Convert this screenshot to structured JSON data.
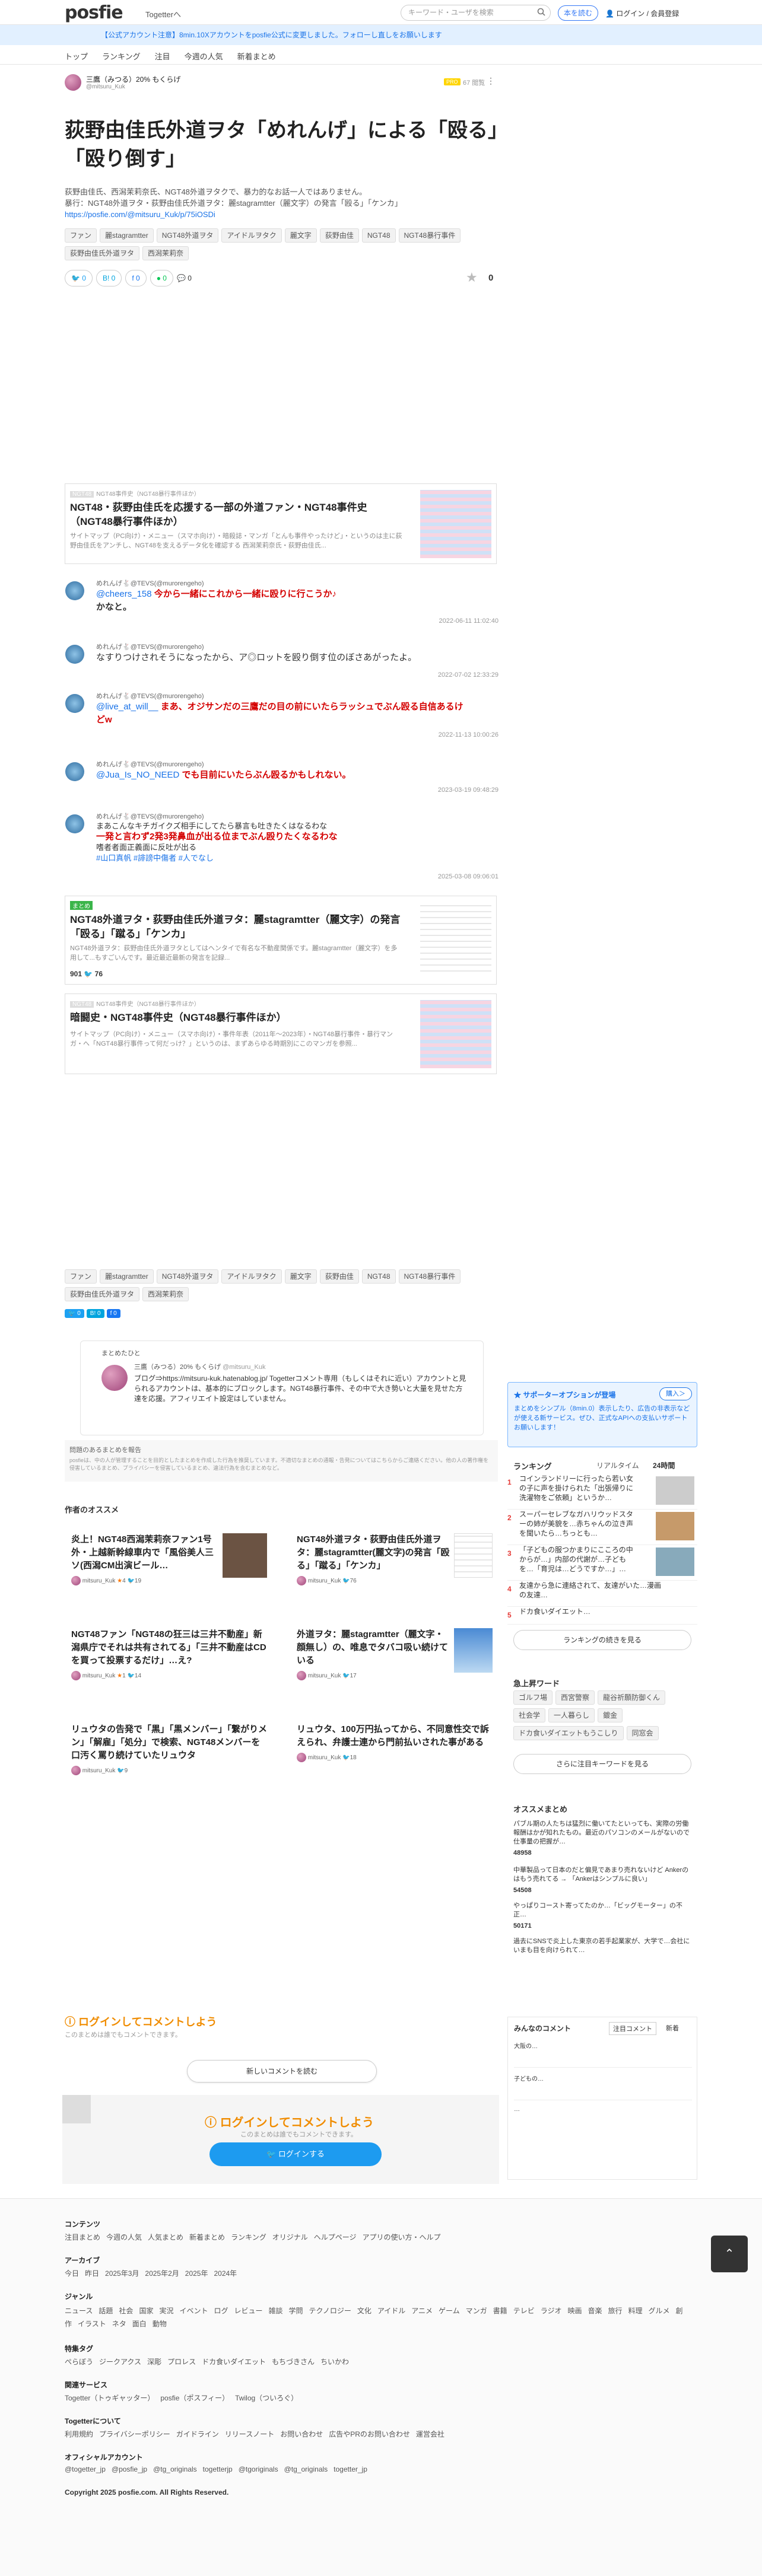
{
  "header": {
    "logo_main": "posfie",
    "logo_suffix": "Togetterへ",
    "search_placeholder": "キーワード・ユーザを検索",
    "cta": "本を読む",
    "login": "ログイン / 会員登録"
  },
  "notice": "【公式アカウント注意】8min.10Xアカウントをposfie公式に変更しました。フォローし直しをお願いします",
  "nav": [
    "トップ",
    "ランキング",
    "注目",
    "今週の人気",
    "新着まとめ"
  ],
  "author": {
    "name": "三鷹（みつる）20% もくらげ",
    "handle": "@mitsuru_Kuk",
    "badge": "PRO",
    "views": "67 閲覧"
  },
  "title": "荻野由佳氏外道ヲタ「めれんげ」による「殴る」「殴り倒す」",
  "desc": [
    "荻野由佳氏、西潟茉莉奈氏、NGT48外道ヲタクで、暴力的なお話一人ではありません。",
    "暴行：NGT48外道ヲタ・荻野由佳氏外道ヲタ：麗stagramtter（麗文字）の発言「殴る」「ケンカ」",
    "https://posfie.com/@mitsuru_Kuk/p/75iOSDi"
  ],
  "tags": [
    "ファン",
    "麗stagramtter",
    "NGT48外道ヲタ",
    "アイドルヲタク",
    "麗文字",
    "荻野由佳",
    "NGT48",
    "NGT48暴行事件",
    "荻野由佳氏外道ヲタ",
    "西潟茉莉奈"
  ],
  "shares": {
    "twitter": "0",
    "hatena": "0",
    "facebook": "0",
    "line": "0",
    "comments": "0",
    "stars": "0"
  },
  "card1": {
    "label": "NGT48",
    "crumb": "NGT48事件史（NGT48暴行事件ほか）",
    "title": "NGT48・荻野由佳氏を応援する一部の外道ファン・NGT48事件史（NGT48暴行事件ほか）",
    "desc": "サイトマップ（PC向け）・メニュー（スマホ向け）・暗殺誌・マンガ「とんも事件やったけど」・というのは主に荻野由佳氏をアンチし、NGT48を支えるデータ化を確認する 西潟茉莉奈氏・荻野由佳氏..."
  },
  "tweets": [
    {
      "user": "めれんげ🐇@TEVS(@murorengeho)",
      "text": "今から一緒にこれから一緒に殴りに行こうか♪",
      "pre": "@cheers_158",
      "post": "かなと。",
      "date": "2022-06-11 11:02:40"
    },
    {
      "user": "めれんげ🐇@TEVS(@murorengeho)",
      "text": "なすりつけされそうになったから、ア◎ロットを殴り倒す位のぼさあがったよ。",
      "pre": "",
      "post": "",
      "date": "2022-07-02 12:33:29"
    },
    {
      "user": "めれんげ🐇@TEVS(@murorengeho)",
      "text": "まあ、オジサンだの三鷹だの目の前にいたらラッシュでぶん殴る自信あるけどw",
      "pre": "@live_at_will__",
      "post": "",
      "date": "2022-11-13 10:00:26"
    },
    {
      "user": "めれんげ🐇@TEVS(@murorengeho)",
      "text": "でも目前にいたらぶん殴るかもしれない。",
      "pre": "@Jua_Is_NO_NEED",
      "post": "",
      "date": "2023-03-19 09:48:29"
    },
    {
      "user": "めれんげ🐇@TEVS(@murorengeho)",
      "text": "一発と言わず2発3発鼻血が出る位までぶん殴りたくなるわな",
      "pre": "まあこんなキチガイクズ相手にしてたら暴言も吐きたくはなるわな",
      "post": "",
      "date": "2025-03-08 09:06:01"
    }
  ],
  "tweet5": {
    "l3": "嗜者者面正義面に反吐が出る",
    "l4": "#山口真帆 #誹謗中傷者 #人でなし"
  },
  "card2": {
    "label": "まとめ",
    "title": "NGT48外道ヲタ・荻野由佳氏外道ヲタ：麗stagramtter（麗文字）の発言「殴る」「蹴る」「ケンカ」",
    "desc": "NGT48外道ヲタ：荻野由佳氏外道ヲタとしてはヘンタイで有名な不動産関係です。麗stagramtter（麗文字）を多用して...もすごいんです。最近最近最新の発言を記録...",
    "count": "901",
    "likes": "76"
  },
  "card3": {
    "label": "NGT48",
    "crumb": "NGT48事件史（NGT48暴行事件ほか）",
    "title": "暗闘史・NGT48事件史（NGT48暴行事件ほか）",
    "desc": "サイトマップ（PC向け）・メニュー（スマホ向け）・事件年表（2011年〜2023年）・NGT48暴行事件・暴行マンガ・へ「NGT48暴行事件って何だっけ？」というのは、まずあらゆる時期別にこのマンガを参照..."
  },
  "author_box": {
    "label": "まとめたひと",
    "name": "三鷹（みつる）20% もくらげ",
    "handle": "@mitsuru_Kuk",
    "bio": "ブログ⇒https://mitsuru-kuk.hatenablog.jp/ Togetterコメント専用（もしくはそれに近い）アカウントと見られるアカウントは、基本的にブロックします。NGT48暴行事件、その中で大き勢いと大量を見せた方達を応援。アフィリエイト設定はしていません。"
  },
  "report": {
    "title": "問題のあるまとめを報告",
    "text": "posfieは、中の人が管理することを目的としたまとめを作成した行為を推奨しています。不適切なまとめの通報・告発についてはこちらからご連絡ください。他の人の著作権を侵害しているまとめ、プライバシーを侵害しているまとめ、違法行為を含むまとめなど。"
  },
  "recommend_title": "作者のオススメ",
  "recommends": [
    {
      "title": "炎上！NGT48西潟茉莉奈ファン1号外・上越新幹線車内で「風俗美人三ソ(西潟CM出演ビール…",
      "user": "mitsuru_Kuk",
      "likes": "4",
      "rt": "19"
    },
    {
      "title": "NGT48外道ヲタ・荻野由佳氏外道ヲタ：麗stagramtter(麗文字)の発言「殴る」「蹴る」「ケンカ」",
      "user": "mitsuru_Kuk",
      "likes": "",
      "rt": "76"
    },
    {
      "title": "NGT48ファン「NGT48の狂三は三井不動産」新潟県庁でそれは共有されてる」「三井不動産はCDを買って投票するだけ」…え?",
      "user": "mitsuru_Kuk",
      "likes": "1",
      "rt": "14"
    },
    {
      "title": "外道ヲタ：麗stagramtter（麗文字・顔無し）の、唯息でタバコ吸い続けている",
      "user": "mitsuru_Kuk",
      "likes": "",
      "rt": "17"
    },
    {
      "title": "リュウタの告発で「黒」「黒メンバー」「繋がりメン」「解雇」「処分」で検索、NGT48メンバーを口汚く罵り続けていたリュウタ",
      "user": "mitsuru_Kuk",
      "likes": "9",
      "rt": ""
    },
    {
      "title": "リュウタ、100万円払ってから、不同意性交で訴えられ、弁護士連から門前払いされた事がある",
      "user": "mitsuru_Kuk",
      "likes": "",
      "rt": "18"
    }
  ],
  "sidebar": {
    "support": {
      "title": "サポーターオプションが登場",
      "btn": "購入＞",
      "text": "まとめをシンプル（8min.0）表示したり、広告の非表示などが使える新サービス。ぜひ、正式なAPIへの支払いサポートお願いします！"
    },
    "ranking_title": "ランキング",
    "tabs": [
      "リアルタイム",
      "24時間"
    ],
    "ranks": [
      "コインランドリーに行ったら若い女の子に声を掛けられた「出張帰りに洗濯物をご依頼」というか…",
      "スーパーセレブなガハリウッドスターの姉が美貌を…赤ちゃんの泣き声を聞いたら…ちっとも…",
      "「子どもの服つかまりにこころの中からが…」内部の代謝が…子どもを…「育児は…どうですか…」…",
      "友達から急に連絡されて、友達がいた…漫画の友達…",
      "ドカ食いダイエット…"
    ],
    "rank_more": "ランキングの続きを見る",
    "trend_title": "急上昇ワード",
    "trends": [
      "ゴルフ場",
      "西宮警察",
      "龍谷祈願防御くん",
      "社会学",
      "一人暮らし",
      "鍍金",
      "ドカ食いダイエットもうこしり",
      "同窓会"
    ],
    "trend_more": "さらに注目キーワードを見る",
    "osusume_title": "オススメまとめ",
    "osusume": [
      {
        "title": "パブル期の人たちは猛烈に働いてたといっても、実際の労働報酬はかが知れたもの。最近のパソコンのメールがないので仕事量の把握が…",
        "count": "48958"
      },
      {
        "title": "中華製品って日本のだと偏見であまり売れないけど Ankerのはもう売れてる → 「Ankerはシンプルに良い」",
        "count": "54508"
      },
      {
        "title": "やっぱりコースト寄ってたのか…「ビッグモーター」の不正…",
        "count": "50171"
      },
      {
        "title": "過去にSNSで炎上した東京の若手起業家が、大学で…会社にいまも目を向けられて…",
        "count": ""
      }
    ],
    "comments_title": "みんなのコメント",
    "comment_tabs": [
      "注目コメント",
      "新着"
    ],
    "comments": [
      "大阪の…",
      "子どもの…",
      "…"
    ]
  },
  "login_comment": {
    "title": "ログインしてコメントしよう",
    "sub": "このまとめは誰でもコメントできます。",
    "new_btn": "新しいコメントを読む",
    "login_btn": "ログインする"
  },
  "footer": {
    "contents_h": "コンテンツ",
    "contents": [
      "注目まとめ",
      "今週の人気",
      "人気まとめ",
      "新着まとめ",
      "ランキング",
      "オリジナル",
      "ヘルプページ",
      "アプリの使い方・ヘルプ"
    ],
    "archive_h": "アーカイブ",
    "archive": [
      "今日",
      "昨日",
      "2025年3月",
      "2025年2月",
      "2025年",
      "2024年"
    ],
    "genre_h": "ジャンル",
    "genre": [
      "ニュース",
      "話題",
      "社会",
      "国家",
      "実況",
      "イベント",
      "ログ",
      "レビュー",
      "雑談",
      "学問",
      "テクノロジー",
      "文化",
      "アイドル",
      "アニメ",
      "ゲーム",
      "マンガ",
      "書籍",
      "テレビ",
      "ラジオ",
      "映画",
      "音楽",
      "旅行",
      "料理",
      "グルメ",
      "創作",
      "イラスト",
      "ネタ",
      "面白",
      "動物"
    ],
    "special_h": "特集タグ",
    "special": [
      "ぺらぼう",
      "ジークアクス",
      "深彫",
      "プロレス",
      "ドカ食いダイエット",
      "もちづきさん",
      "ちいかわ"
    ],
    "related_h": "関連サービス",
    "related": [
      "Togetter（トゥギャッター）",
      "posfie（ポスフィー）",
      "Twilog（ついろぐ）"
    ],
    "about_h": "Togetterについて",
    "about": [
      "利用規約",
      "プライバシーポリシー",
      "ガイドライン",
      "リリースノート",
      "お問い合わせ",
      "広告やPRのお問い合わせ",
      "運営会社"
    ],
    "official_h": "オフィシャルアカウント",
    "official": [
      "@togetter_jp",
      "@posfie_jp",
      "@tg_originals",
      "togetterjp",
      "@tgoriginals",
      "@tg_originals",
      "togetter_jp"
    ],
    "copyright": "Copyright 2025 posfie.com. All Rights Reserved."
  }
}
